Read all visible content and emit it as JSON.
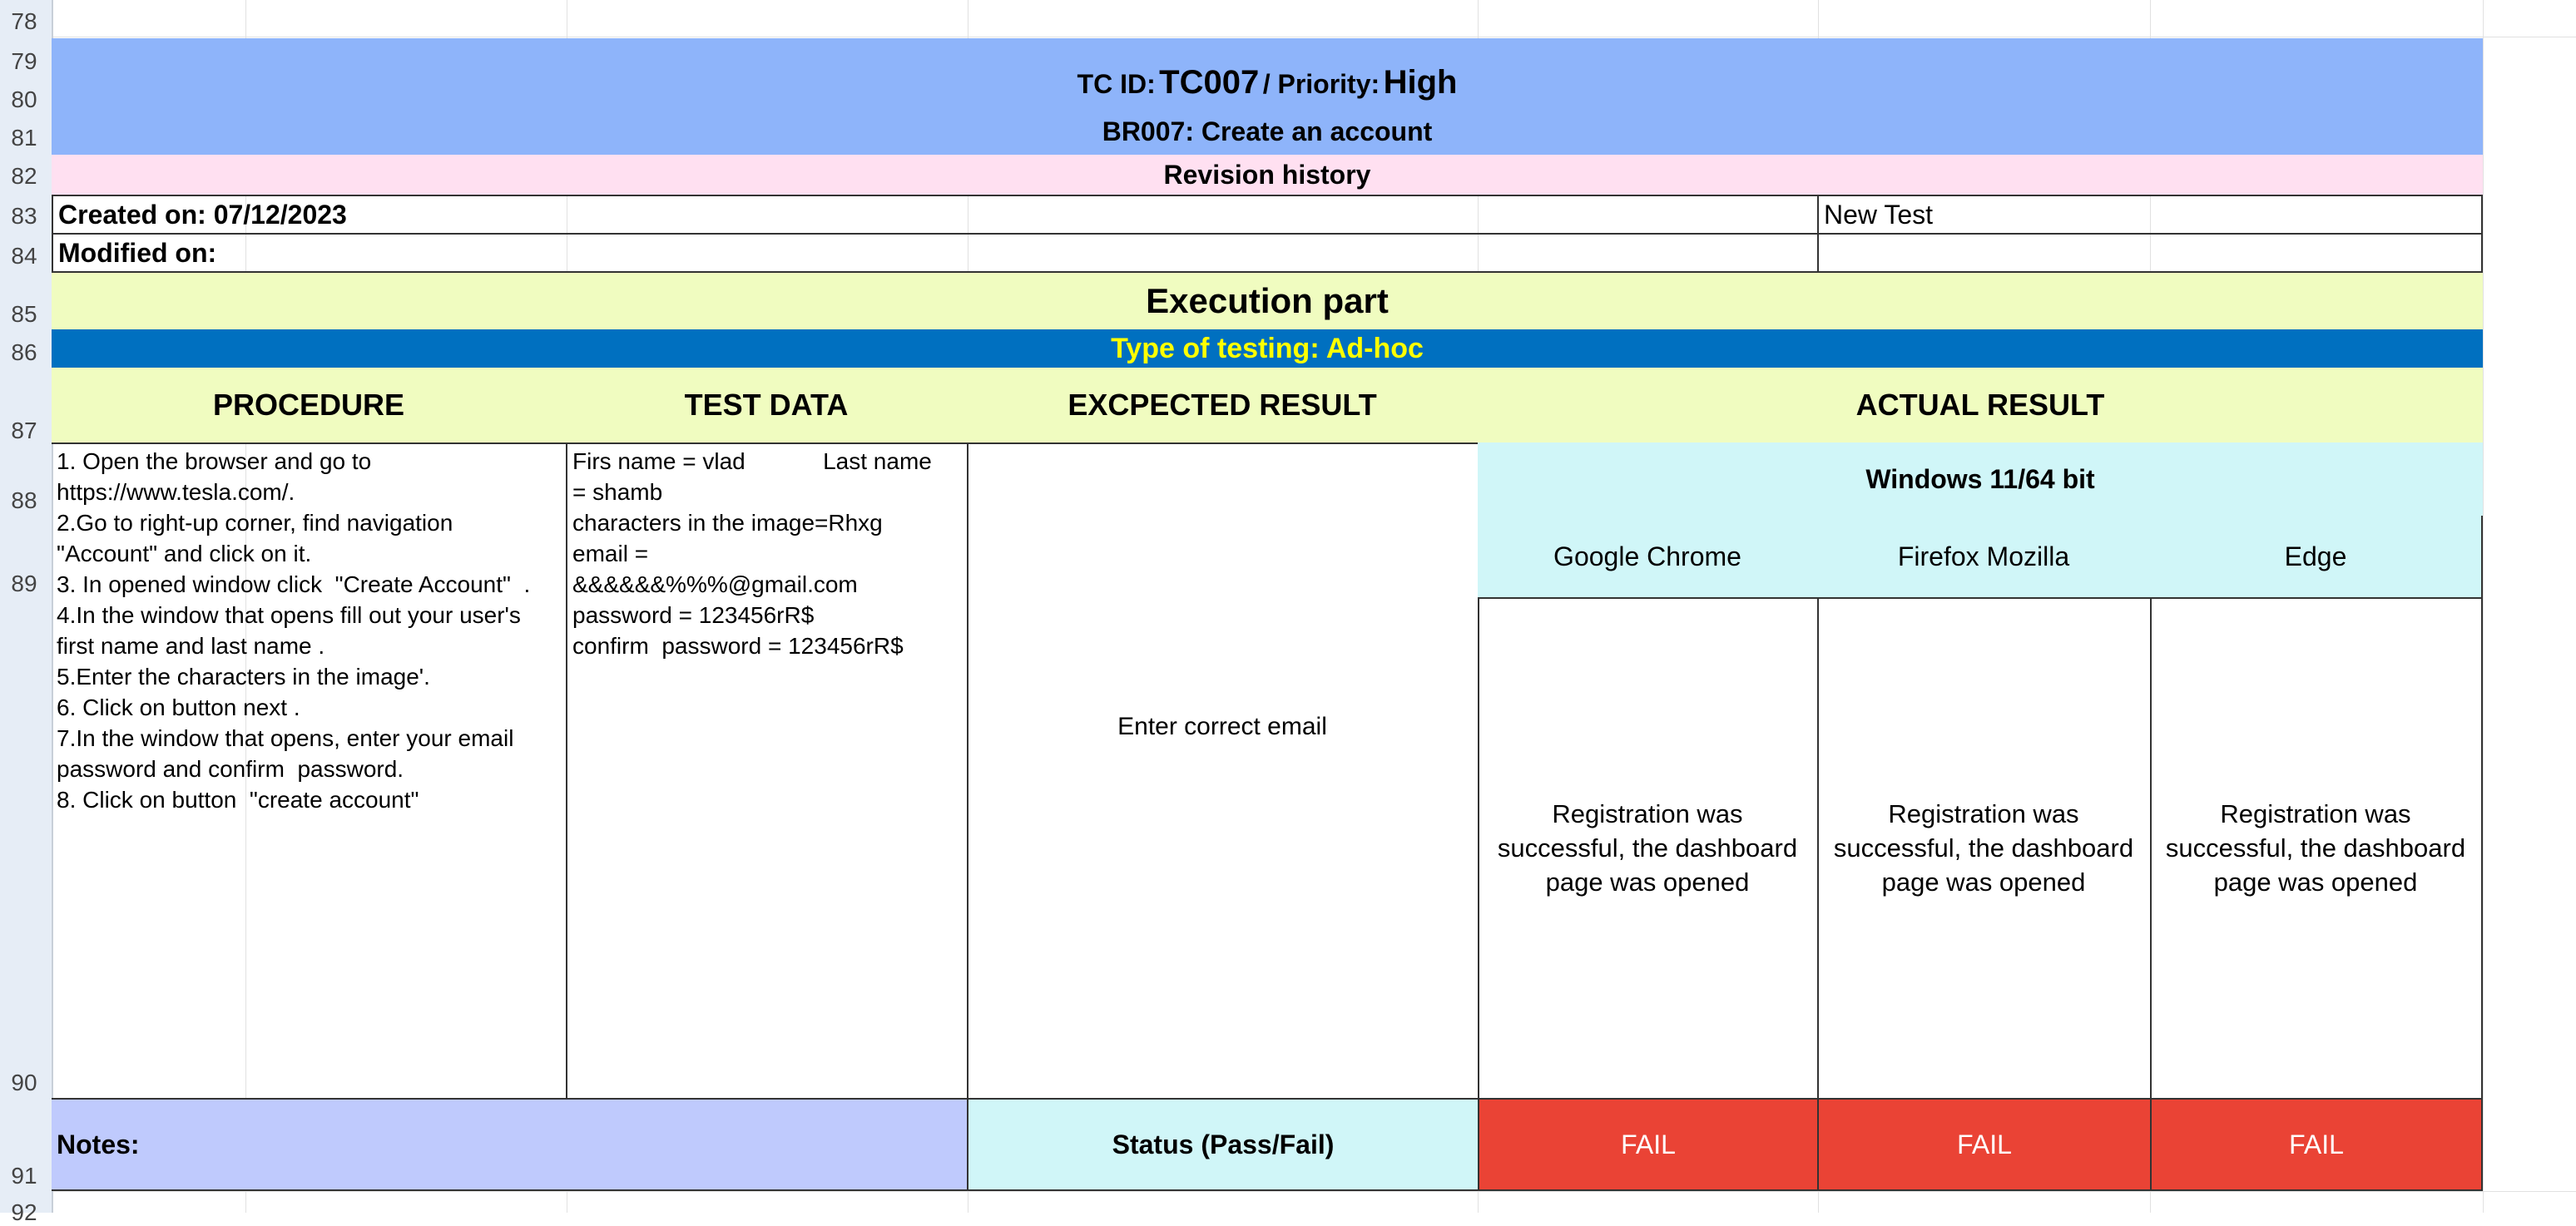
{
  "rows": [
    "78",
    "79",
    "80",
    "81",
    "82",
    "83",
    "84",
    "85",
    "86",
    "87",
    "88",
    "89",
    "90",
    "91",
    "92"
  ],
  "header": {
    "tc_id_label": "TC ID:",
    "tc_id_value": "TC007",
    "priority_label": "/ Priority:",
    "priority_value": "High",
    "br_title": "BR007: Create an account"
  },
  "revision": {
    "title": "Revision history",
    "created_on": "Created on: 07/12/2023",
    "modified_on": "Modified on:",
    "note": "New Test"
  },
  "execution": {
    "title": "Execution part",
    "type_of_testing": "Type of testing: Ad-hoc"
  },
  "columns": {
    "procedure": "PROCEDURE",
    "test_data": "TEST DATA",
    "expected": "EXCPECTED RESULT",
    "actual": "ACTUAL RESULT"
  },
  "environment": {
    "os": "Windows 11/64 bit",
    "browsers": [
      "Google Chrome",
      "Firefox Mozilla",
      "Edge"
    ]
  },
  "procedure_text": "1. Open the browser and go to\nhttps://www.tesla.com/.\n2.Go to right-up corner, find navigation\n\"Account\" and click on it.\n3. In opened window click  \"Create Account\"  .\n4.In the window that opens fill out your user's\nfirst name and last name .\n5.Enter the characters in the image'.\n6. Click on button next .\n7.In the window that opens, enter your email\npassword and confirm  password.\n8. Click on button  \"create account\"",
  "test_data_text": "Firs name = vlad            Last name\n= shamb\ncharacters in the image=Rhxg\nemail =\n&&&&&&%%%@gmail.com\npassword = 123456rR$\nconfirm  password = 123456rR$",
  "expected_result": "Enter correct email",
  "actual_results": [
    "Registration was\nsuccessful, the dashboard\npage was opened",
    "Registration was\nsuccessful, the dashboard\npage was opened",
    "Registration was\nsuccessful, the dashboard\npage was opened"
  ],
  "footer": {
    "notes_label": "Notes:",
    "status_label": "Status (Pass/Fail)",
    "statuses": [
      "FAIL",
      "FAIL",
      "FAIL"
    ]
  },
  "colors": {
    "header_blue": "#8eb4fa",
    "revision_pink": "#ffe0f1",
    "execution_green": "#f0fcc0",
    "type_bar": "#0070c0",
    "type_text": "#ffff00",
    "env_cyan": "#d0f6f8",
    "notes_lavender": "#bfcafd",
    "fail_red": "#ea4335"
  }
}
